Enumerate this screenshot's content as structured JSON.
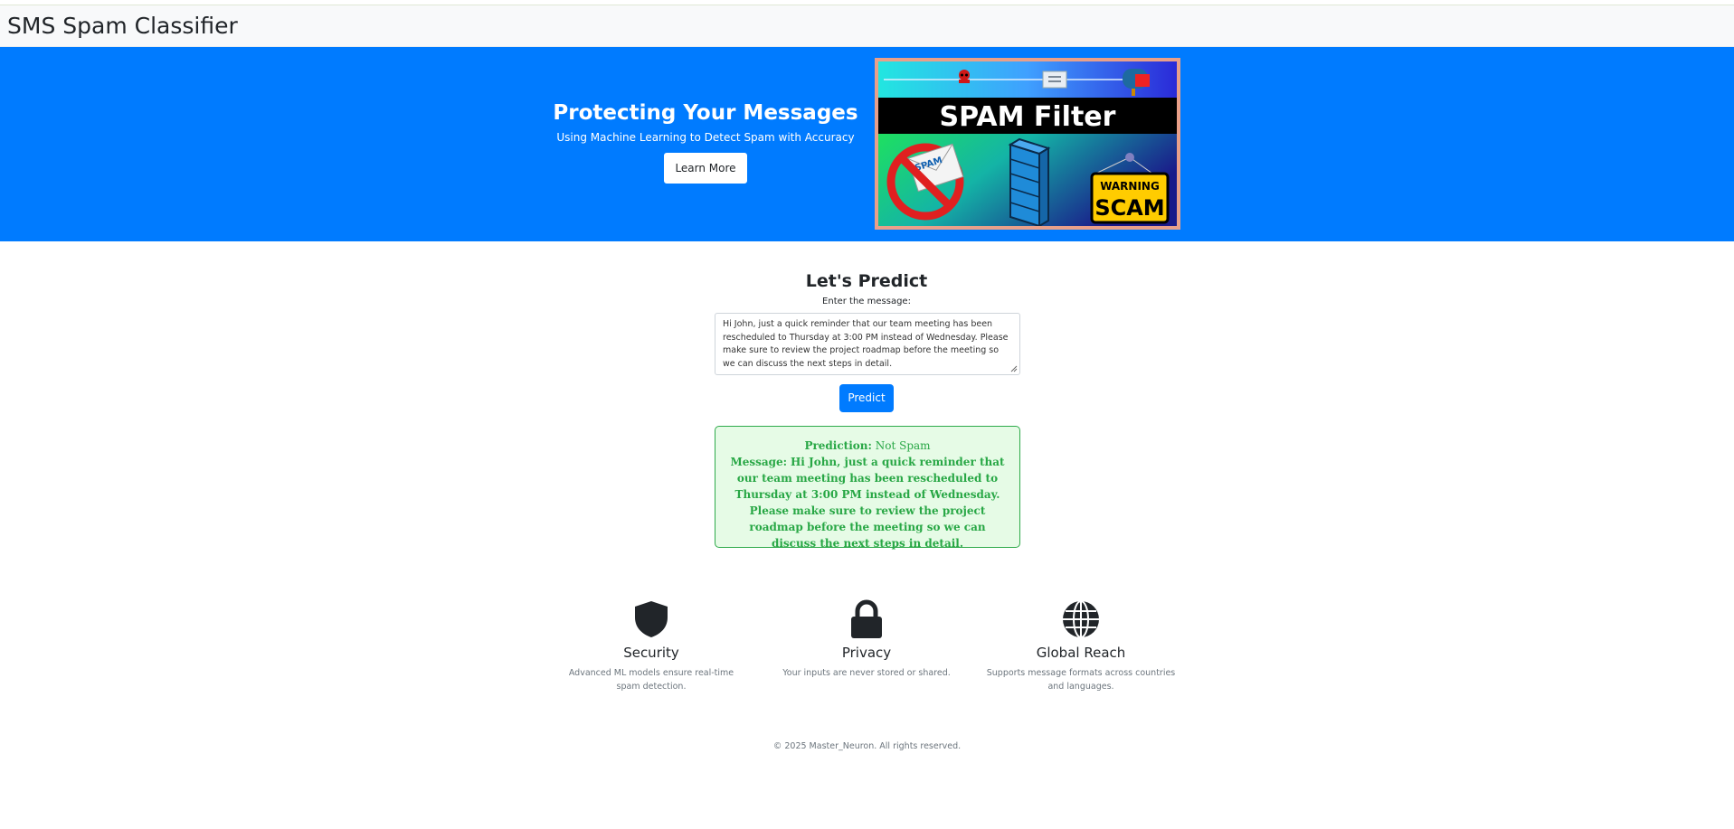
{
  "navbar": {
    "brand": "SMS Spam Classifier"
  },
  "hero": {
    "title": "Protecting Your Messages",
    "subtitle": "Using Machine Learning to Detect Spam with Accuracy",
    "button": "Learn More",
    "image": {
      "banner_text": "SPAM Filter",
      "envelope_text": "SPAM",
      "sign_top": "WARNING",
      "sign_main": "SCAM"
    }
  },
  "predict": {
    "title": "Let's Predict",
    "label": "Enter the message:",
    "message_value": "Hi John, just a quick reminder that our team meeting has been rescheduled to Thursday at 3:00 PM instead of Wednesday. Please make sure to review the project roadmap before the meeting so we can discuss the next steps in detail.",
    "button": "Predict"
  },
  "result": {
    "prediction_label": "Prediction:",
    "prediction_value": "Not Spam",
    "message_label": "Message:",
    "message_value": "Hi John, just a quick reminder that our team meeting has been rescheduled to Thursday at 3:00 PM instead of Wednesday. Please make sure to review the project roadmap before the meeting so we can discuss the next steps in detail."
  },
  "features": [
    {
      "icon": "shield-icon",
      "title": "Security",
      "desc": "Advanced ML models ensure real-time spam detection."
    },
    {
      "icon": "lock-icon",
      "title": "Privacy",
      "desc": "Your inputs are never stored or shared."
    },
    {
      "icon": "globe-icon",
      "title": "Global Reach",
      "desc": "Supports message formats across countries and languages."
    }
  ],
  "footer": {
    "text": "© 2025 Master_Neuron. All rights reserved."
  },
  "colors": {
    "primary": "#007bff",
    "success": "#28a745",
    "success_bg": "#e6fbe6"
  }
}
